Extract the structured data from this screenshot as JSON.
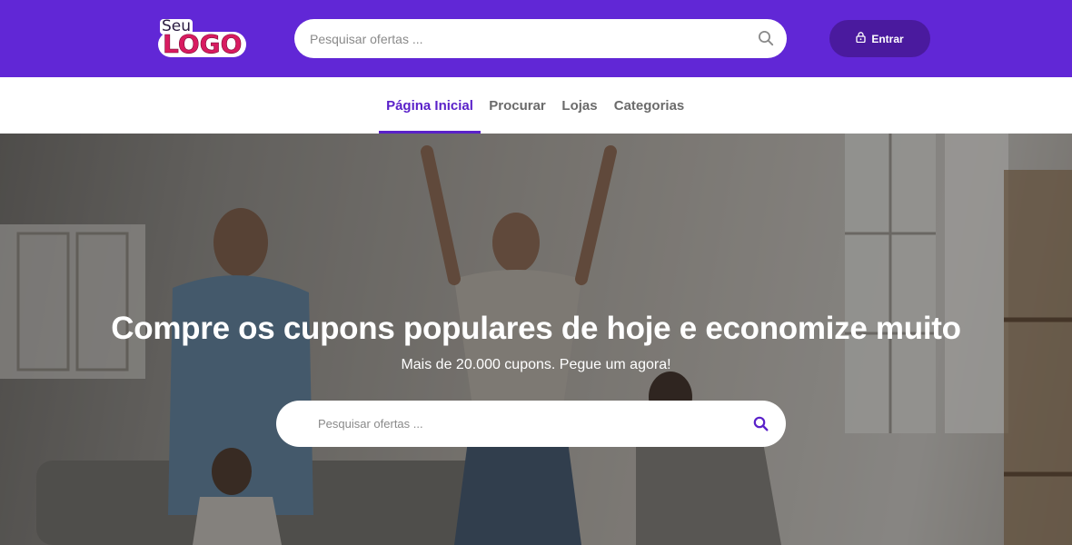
{
  "header": {
    "logo_small": "Seu",
    "logo_large": "LOGO",
    "search_placeholder": "Pesquisar ofertas ...",
    "login_label": "Entrar",
    "colors": {
      "brand": "#6127d6",
      "button": "#4a1a9e"
    }
  },
  "nav": {
    "items": [
      {
        "label": "Página Inicial",
        "active": true
      },
      {
        "label": "Procurar",
        "active": false
      },
      {
        "label": "Lojas",
        "active": false
      },
      {
        "label": "Categorias",
        "active": false
      }
    ],
    "active_color": "#5a21c9"
  },
  "hero": {
    "title": "Compre os cupons populares de hoje e economize muito",
    "subtitle": "Mais de 20.000 cupons. Pegue um agora!",
    "search_placeholder": "Pesquisar ofertas ..."
  },
  "icons": {
    "search": "search-icon",
    "lock": "lock-icon"
  }
}
